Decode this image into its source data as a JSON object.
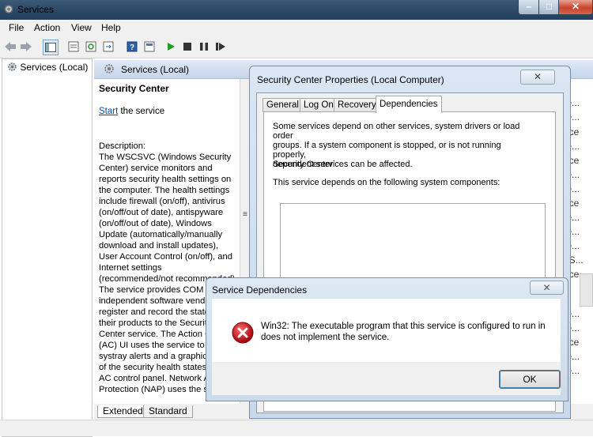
{
  "window": {
    "title": "Services"
  },
  "menu": [
    "File",
    "Action",
    "View",
    "Help"
  ],
  "tree": {
    "root_label": "Services (Local)"
  },
  "panel": {
    "header": "Services (Local)"
  },
  "service": {
    "name": "Security Center",
    "start_link": "Start",
    "start_suffix": " the service",
    "description": "Description:\nThe WSCSVC (Windows Security Center) service monitors and reports security health settings on the computer.  The health settings include firewall (on/off), antivirus (on/off/out of date), antispyware (on/off/out of date), Windows Update (automatically/manually download and install updates), User Account Control (on/off), and Internet settings (recommended/not recommended). The service provides COM APIs for independent software vendors to register and record the state of their products to the Security Center service.  The Action Center (AC) UI uses the service to provide systray alerts and a graphical view of the security health states in the AC control panel.  Network Access Protection (NAP) uses the service"
  },
  "list": {
    "header": "As",
    "rows": [
      "ste...",
      "ste...",
      "rvice",
      "ste...",
      "rvice",
      "ste...",
      "ste...",
      "rvice",
      "ste...",
      "ste...",
      "ste...",
      "ct S...",
      "rvice",
      "ste...",
      "ste...",
      "rvice",
      "ste...",
      "ste..."
    ]
  },
  "bottom_tabs": [
    "Extended",
    "Standard"
  ],
  "properties": {
    "title": "Security Center Properties (Local Computer)",
    "close": "✕",
    "tabs": [
      "General",
      "Log On",
      "Recovery",
      "Dependencies"
    ],
    "active_tab": "Dependencies",
    "intro": "Some services depend on other services, system drivers or load order\ngroups. If a system component is stopped, or is not running properly,\ndependent services can be affected.",
    "service_name": "Security Center",
    "depends_label": "This service depends on the following system components:"
  },
  "dependencies_dialog": {
    "title": "Service Dependencies",
    "close": "✕",
    "message": "Win32: The executable program that this service is configured to run in does not implement the service.",
    "ok": "OK"
  },
  "colors": {
    "error_red": "#c0141c",
    "link_blue": "#0645ad",
    "accent": "#3c7fb1"
  }
}
